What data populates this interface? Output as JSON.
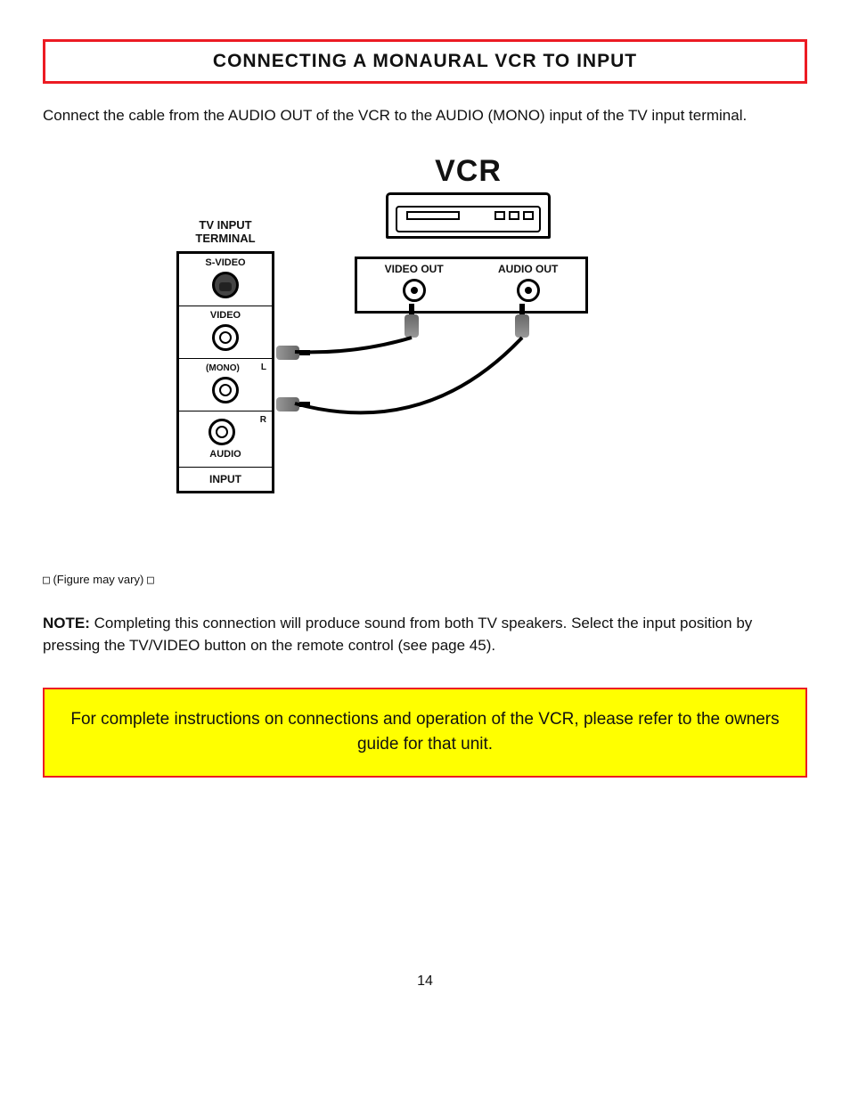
{
  "title": "CONNECTING A MONAURAL VCR TO INPUT",
  "intro": "Connect the cable from the AUDIO OUT of the VCR to the AUDIO (MONO) input of the TV input terminal.",
  "diagram": {
    "vcr_label": "VCR",
    "ports": {
      "video_out": "VIDEO OUT",
      "audio_out": "AUDIO OUT"
    },
    "tv_terminal_title_line1": "TV INPUT",
    "tv_terminal_title_line2": "TERMINAL",
    "tv_labels": {
      "svideo": "S-VIDEO",
      "video": "VIDEO",
      "mono": "(MONO)",
      "l": "L",
      "r": "R",
      "audio": "AUDIO",
      "input": "INPUT"
    }
  },
  "caption_prefix": "(Figure may vary)",
  "caption_rest": "",
  "note_lead": "NOTE:",
  "note_body": " Completing this connection will produce sound from both TV speakers. Select the input position by pressing the TV/VIDEO button on the remote control (see page 45).",
  "yellow_box": "For complete instructions on connections and operation of the VCR, please refer to the owners guide for that unit.",
  "page_number": "14"
}
